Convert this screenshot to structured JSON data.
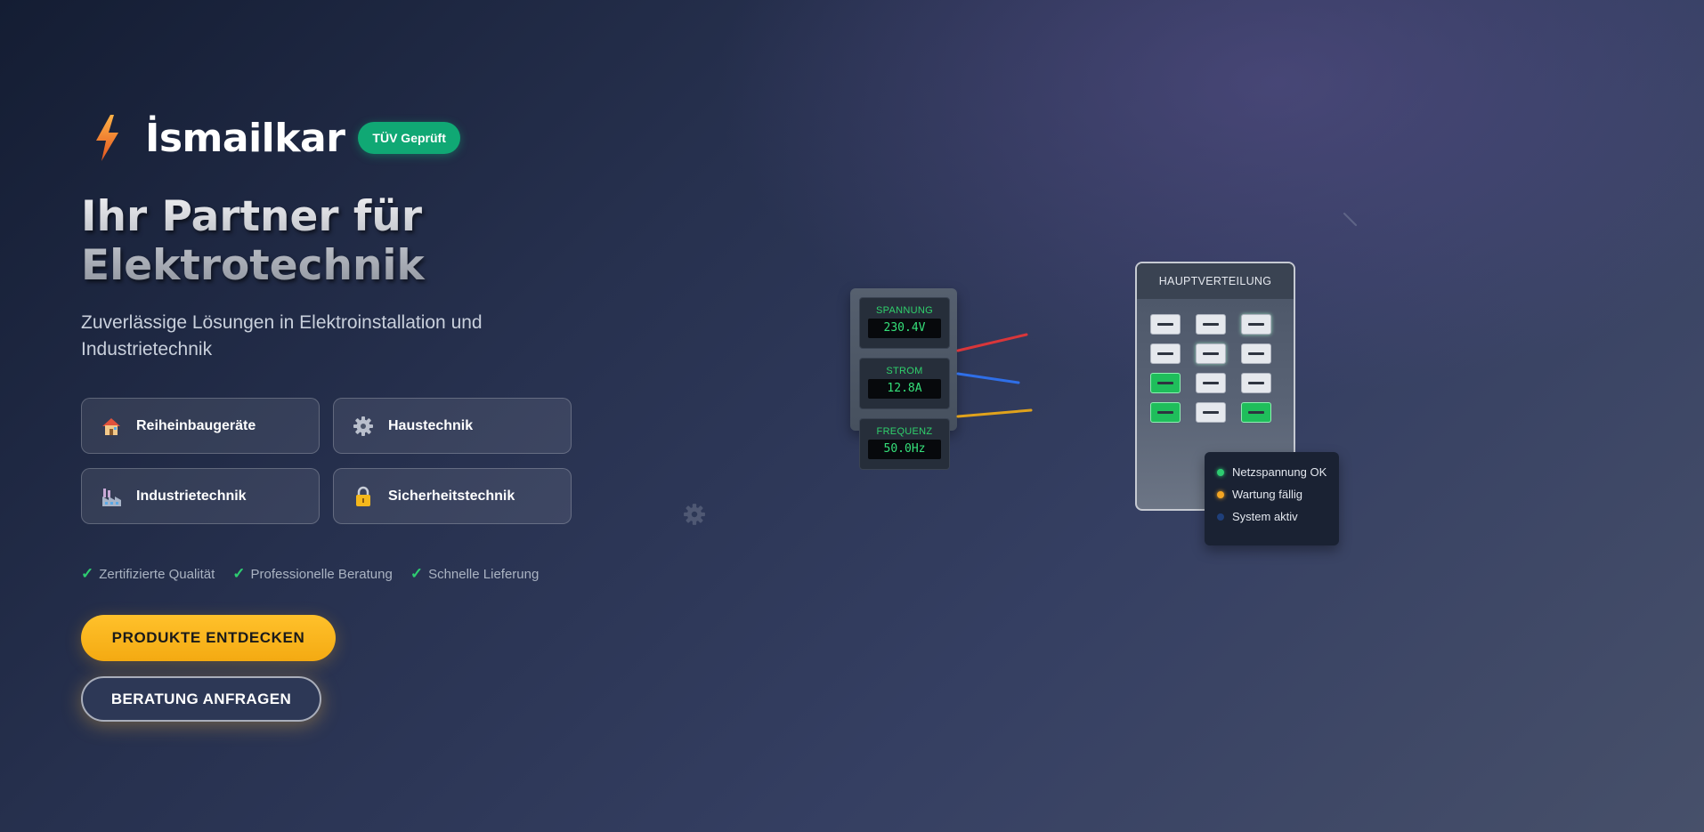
{
  "brand": {
    "name": "İsmailkar",
    "badge": "TÜV Geprüft",
    "icon": "lightning-bolt-icon"
  },
  "hero": {
    "headline_line1": "Ihr Partner für",
    "headline_line2": "Elektrotechnik",
    "subline": "Zuverlässige Lösungen in Elektroinstallation und Industrietechnik"
  },
  "categories": [
    {
      "label": "Reiheinbaugeräte",
      "icon": "house-icon"
    },
    {
      "label": "Haustechnik",
      "icon": "gear-icon"
    },
    {
      "label": "Industrietechnik",
      "icon": "factory-icon"
    },
    {
      "label": "Sicherheitstechnik",
      "icon": "lock-icon"
    }
  ],
  "features": [
    "Zertifizierte Qualität",
    "Professionelle Beratung",
    "Schnelle Lieferung"
  ],
  "buttons": {
    "primary": "PRODUKTE ENTDECKEN",
    "secondary": "BERATUNG ANFRAGEN"
  },
  "meters": [
    {
      "label": "SPANNUNG",
      "value": "230.4V"
    },
    {
      "label": "STROM",
      "value": "12.8A"
    },
    {
      "label": "FREQUENZ",
      "value": "50.0Hz"
    }
  ],
  "distribution": {
    "title": "HAUPTVERTEILUNG",
    "breakers": [
      {
        "state": "off",
        "glow": false
      },
      {
        "state": "off",
        "glow": false
      },
      {
        "state": "off",
        "glow": true
      },
      {
        "state": "off",
        "glow": false
      },
      {
        "state": "off",
        "glow": true
      },
      {
        "state": "off",
        "glow": false
      },
      {
        "state": "on",
        "glow": false
      },
      {
        "state": "off",
        "glow": false
      },
      {
        "state": "off",
        "glow": false
      },
      {
        "state": "on",
        "glow": false
      },
      {
        "state": "off",
        "glow": false
      },
      {
        "state": "on",
        "glow": false
      }
    ]
  },
  "status": [
    {
      "label": "Netzspannung OK",
      "color": "#2ecc71"
    },
    {
      "label": "Wartung fällig",
      "color": "#f5a623"
    },
    {
      "label": "System aktiv",
      "color": "#1f3f7a"
    }
  ],
  "colors": {
    "accent_yellow": "#f4aa12",
    "badge_green": "#10a874",
    "indicator_green": "#2ecc71"
  }
}
